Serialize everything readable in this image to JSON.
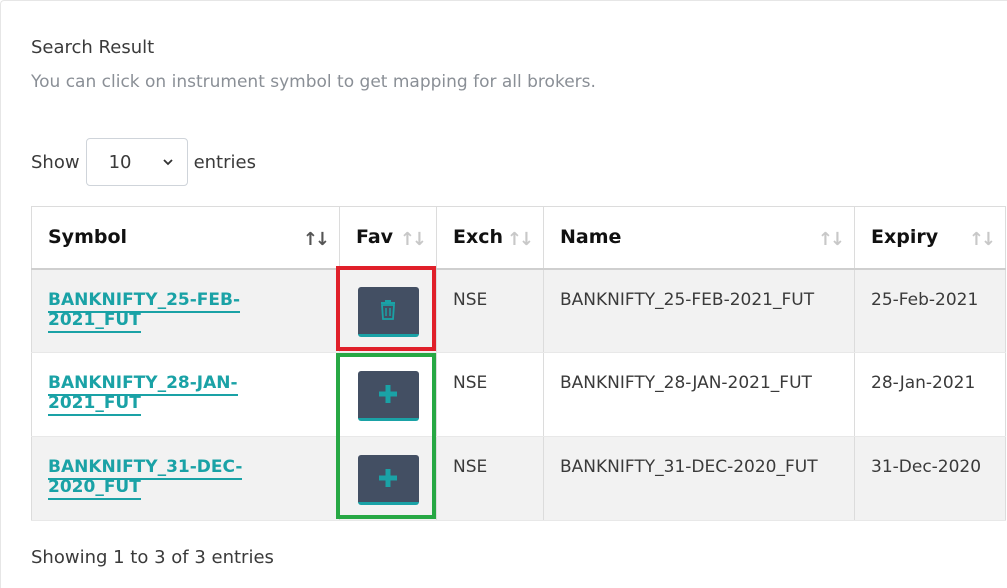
{
  "header": {
    "title": "Search Result",
    "subtitle": "You can click on instrument symbol to get mapping for all brokers."
  },
  "length_menu": {
    "prefix": "Show",
    "selected": "10",
    "suffix": "entries"
  },
  "table": {
    "columns": [
      {
        "label": "Symbol",
        "sort": "active"
      },
      {
        "label": "Fav",
        "sort": "none"
      },
      {
        "label": "Exch",
        "sort": "none"
      },
      {
        "label": "Name",
        "sort": "none"
      },
      {
        "label": "Expiry",
        "sort": "none"
      }
    ],
    "rows": [
      {
        "symbol": "BANKNIFTY_25-FEB-2021_FUT",
        "fav_action": "delete",
        "exch": "NSE",
        "name": "BANKNIFTY_25-FEB-2021_FUT",
        "expiry": "25-Feb-2021"
      },
      {
        "symbol": "BANKNIFTY_28-JAN-2021_FUT",
        "fav_action": "add",
        "exch": "NSE",
        "name": "BANKNIFTY_28-JAN-2021_FUT",
        "expiry": "28-Jan-2021"
      },
      {
        "symbol": "BANKNIFTY_31-DEC-2020_FUT",
        "fav_action": "add",
        "exch": "NSE",
        "name": "BANKNIFTY_31-DEC-2020_FUT",
        "expiry": "31-Dec-2020"
      }
    ]
  },
  "footer": {
    "info": "Showing 1 to 3 of 3 entries"
  },
  "colors": {
    "link": "#1aa2a6",
    "button_bg": "#434f63",
    "highlight_red": "#e0202a",
    "highlight_green": "#27a844"
  },
  "icons": {
    "delete": "trash-icon",
    "add": "plus-icon",
    "sort": "sort-arrows-icon"
  }
}
